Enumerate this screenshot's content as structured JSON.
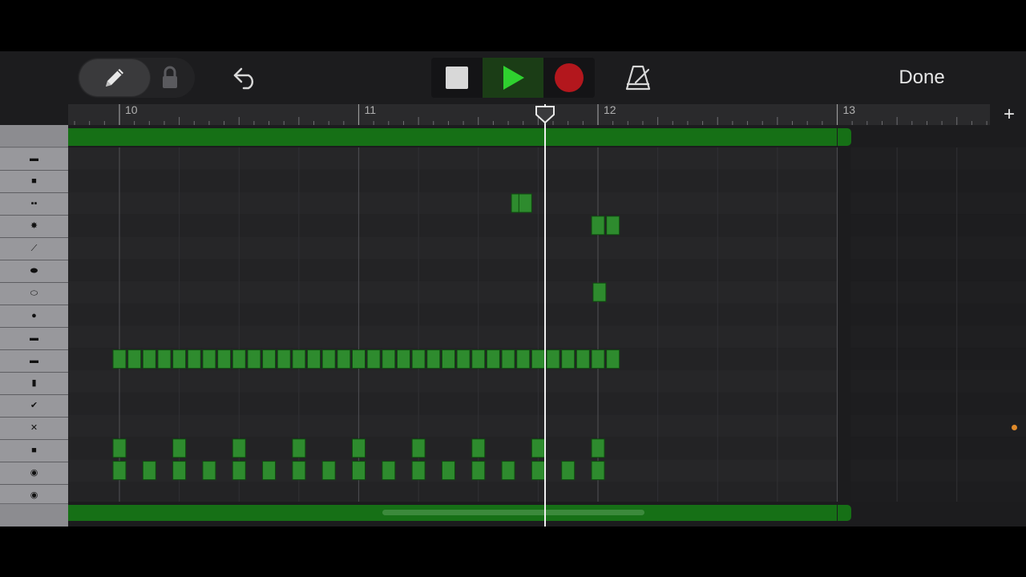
{
  "toolbar": {
    "pencil_icon": "pencil-icon",
    "lock_icon": "lock-icon",
    "undo_icon": "undo-arrow-icon",
    "stop_icon": "stop-square-icon",
    "play_icon": "play-triangle-icon",
    "record_icon": "record-dot-icon",
    "metronome_icon": "metronome-icon",
    "done_label": "Done"
  },
  "ruler": {
    "bars": [
      {
        "label": "10",
        "bar": 10
      },
      {
        "label": "11",
        "bar": 11
      },
      {
        "label": "12",
        "bar": 12
      },
      {
        "label": "13",
        "bar": 13
      }
    ],
    "add_label": "+"
  },
  "colors": {
    "note": "#2e8b2e",
    "note_border": "#0f4a0f",
    "region": "#167016",
    "playhead": "#f0f0f0",
    "record": "#b3171d",
    "play": "#2fd12f"
  },
  "region": {
    "start_bar": 9.787,
    "end_bar": 13.0
  },
  "playhead_bar": 11.78,
  "lanes": [
    {
      "icon": "▬"
    },
    {
      "icon": "■"
    },
    {
      "icon": "▪▪"
    },
    {
      "icon": "✸"
    },
    {
      "icon": "⟋"
    },
    {
      "icon": "⬬"
    },
    {
      "icon": "⬭"
    },
    {
      "icon": "●"
    },
    {
      "icon": "▬"
    },
    {
      "icon": "▬"
    },
    {
      "icon": "▮"
    },
    {
      "icon": "✔"
    },
    {
      "icon": "✕"
    },
    {
      "icon": "■"
    },
    {
      "icon": "◉"
    },
    {
      "icon": "◉"
    }
  ],
  "notes": [
    {
      "lane": 2,
      "beats": [
        13.32,
        13.57
      ]
    },
    {
      "lane": 3,
      "beats": [
        16.0,
        16.5
      ]
    },
    {
      "lane": 6,
      "beats": [
        16.05
      ]
    },
    {
      "lane": 9,
      "beats": [
        0.0,
        0.5,
        1.0,
        1.5,
        2.0,
        2.5,
        3.0,
        3.5,
        4.0,
        4.5,
        5.0,
        5.5,
        6.0,
        6.5,
        7.0,
        7.5,
        8.0,
        8.5,
        9.0,
        9.5,
        10.0,
        10.5,
        11.0,
        11.5,
        12.0,
        12.5,
        13.0,
        13.5,
        14.0,
        14.5,
        15.0,
        15.5,
        16.0,
        16.5
      ]
    },
    {
      "lane": 13,
      "beats": [
        0.0,
        2.0,
        4.0,
        6.0,
        8.0,
        10.0,
        12.0,
        14.0,
        16.0
      ]
    },
    {
      "lane": 14,
      "beats": [
        0.0,
        1.0,
        2.0,
        3.0,
        4.0,
        5.0,
        6.0,
        7.0,
        8.0,
        9.0,
        10.0,
        11.0,
        12.0,
        13.0,
        14.0,
        15.0,
        16.0
      ]
    }
  ]
}
